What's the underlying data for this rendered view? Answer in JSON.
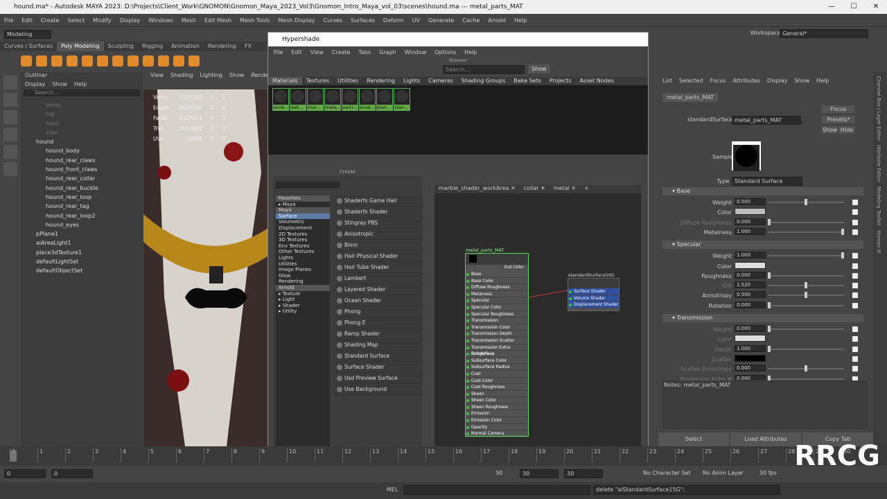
{
  "app": {
    "title": "hound.ma* - Autodesk MAYA 2023: D:\\Projects\\Client_Work\\GNOMON\\Gnomon_Maya_2023_Vol3\\Gnomon_Intro_Maya_vol_03\\scenes\\hound.ma   ---   metal_parts_MAT",
    "min": "—",
    "max": "☐",
    "close": "✕"
  },
  "menu": [
    "File",
    "Edit",
    "Create",
    "Select",
    "Modify",
    "Display",
    "Windows",
    "Mesh",
    "Edit Mesh",
    "Mesh Tools",
    "Mesh Display",
    "Curves",
    "Surfaces",
    "Deform",
    "UV",
    "Generate",
    "Cache",
    "Arnold",
    "Help"
  ],
  "workspace": {
    "label": "Workspace:",
    "value": "General*"
  },
  "mode": "Modeling",
  "shelf_tabs": [
    "Curves / Surfaces",
    "Poly Modeling",
    "Sculpting",
    "Rigging",
    "Animation",
    "Rendering",
    "FX"
  ],
  "shelf_active": "Poly Modeling",
  "outliner": {
    "title": "Outliner",
    "menu": [
      "Display",
      "Show",
      "Help"
    ],
    "search": "Search...",
    "items": [
      {
        "name": "persp",
        "indent": 1,
        "dim": true
      },
      {
        "name": "top",
        "indent": 1,
        "dim": true
      },
      {
        "name": "front",
        "indent": 1,
        "dim": true
      },
      {
        "name": "side",
        "indent": 1,
        "dim": true
      },
      {
        "name": "hound",
        "indent": 0,
        "dim": false
      },
      {
        "name": "hound_body",
        "indent": 1,
        "dim": false
      },
      {
        "name": "hound_rear_claws",
        "indent": 1,
        "dim": false
      },
      {
        "name": "hound_front_claws",
        "indent": 1,
        "dim": false
      },
      {
        "name": "hound_rear_collar",
        "indent": 1,
        "dim": false
      },
      {
        "name": "hound_rear_buckle",
        "indent": 1,
        "dim": false
      },
      {
        "name": "hound_rear_loop",
        "indent": 1,
        "dim": false
      },
      {
        "name": "hound_rear_tag",
        "indent": 1,
        "dim": false
      },
      {
        "name": "hound_rear_loop2",
        "indent": 1,
        "dim": false
      },
      {
        "name": "hound_eyes",
        "indent": 1,
        "dim": false
      },
      {
        "name": "pPlane1",
        "indent": 0,
        "dim": false
      },
      {
        "name": "aiAreaLight1",
        "indent": 0,
        "dim": false
      },
      {
        "name": "place3dTexture1",
        "indent": 0,
        "dim": false
      },
      {
        "name": "defaultLightSet",
        "indent": 0,
        "dim": false
      },
      {
        "name": "defaultObjectSet",
        "indent": 0,
        "dim": false
      }
    ]
  },
  "viewport": {
    "menu": [
      "View",
      "Shading",
      "Lighting",
      "Show",
      "Renderer"
    ],
    "stats": [
      {
        "k": "Verts:",
        "a": "3327344",
        "b": "0",
        "c": "0"
      },
      {
        "k": "Edges:",
        "a": "6654330",
        "b": "0",
        "c": "0"
      },
      {
        "k": "Faces:",
        "a": "3327024",
        "b": "0",
        "c": "0"
      },
      {
        "k": "Tris:",
        "a": "6654048",
        "b": "0",
        "c": "0"
      },
      {
        "k": "UVs:",
        "a": "39848",
        "b": "0",
        "c": "0"
      }
    ]
  },
  "hypershade": {
    "title": "Hypershade",
    "menu": [
      "File",
      "Edit",
      "View",
      "Create",
      "Tabs",
      "Graph",
      "Window",
      "Options",
      "Help"
    ],
    "browser_label": "Browser",
    "search": "Search...",
    "show_btn": "Show",
    "tabs": [
      "Materials",
      "Textures",
      "Utilities",
      "Rendering",
      "Lights",
      "Cameras",
      "Shading Groups",
      "Bake Sets",
      "Projects",
      "Asset Nodes"
    ],
    "swatches": [
      "lamb...",
      "leat...",
      "mar...",
      "meta...",
      "parti...",
      "shad...",
      "stan...",
      "stan..."
    ],
    "create_label": "Create",
    "tree": [
      {
        "t": "Favorites",
        "g": true
      },
      {
        "t": "▸ Maya",
        "g": false
      },
      {
        "t": "Maya",
        "g": true
      },
      {
        "t": "Surface",
        "s": true
      },
      {
        "t": "Volumetric"
      },
      {
        "t": "Displacement"
      },
      {
        "t": "2D Textures"
      },
      {
        "t": "3D Textures"
      },
      {
        "t": "Env Textures"
      },
      {
        "t": "Other Textures"
      },
      {
        "t": "Lights"
      },
      {
        "t": "Utilities"
      },
      {
        "t": "Image Planes"
      },
      {
        "t": "Glow"
      },
      {
        "t": "Rendering"
      },
      {
        "t": "Arnold",
        "g": true
      },
      {
        "t": "▸ Texture"
      },
      {
        "t": "▸ Light"
      },
      {
        "t": "▸ Shader"
      },
      {
        "t": "▸ Utility"
      }
    ],
    "shaders": [
      "Shaderfx Game Hair",
      "Shaderfx Shader",
      "Stingray PBS",
      "Anisotropic",
      "Blinn",
      "Hair Physical Shader",
      "Hair Tube Shader",
      "Lambert",
      "Layered Shader",
      "Ocean Shader",
      "Phong",
      "Phong E",
      "Ramp Shader",
      "Shading Map",
      "Standard Surface",
      "Surface Shader",
      "Usd Preview Surface",
      "Use Background"
    ],
    "graph_tabs": [
      "marble_shader_workArea ✕",
      "collar ✕",
      "metal ✕",
      "+"
    ],
    "node1": {
      "title": "metal_parts_MAT",
      "out": "Out Color",
      "ports": [
        "Base",
        "Base Color",
        "Diffuse Roughness",
        "Metalness",
        "Specular",
        "Specular Color",
        "Specular Roughness",
        "Transmission",
        "Transmission Color",
        "Transmission Depth",
        "Transmission Scatter",
        "Transmission Extra Roughness",
        "Subsurface",
        "Subsurface Color",
        "Subsurface Radius",
        "Coat",
        "Coat Color",
        "Coat Roughness",
        "Sheen",
        "Sheen Color",
        "Sheen Roughness",
        "Emission",
        "Emission Color",
        "Opacity",
        "Normal Camera"
      ]
    },
    "node2": {
      "title": "standardSurface5SG",
      "ports": [
        "Surface Shader",
        "Volume Shader",
        "Displacement Shader"
      ]
    }
  },
  "attr": {
    "menu": [
      "List",
      "Selected",
      "Focus",
      "Attributes",
      "Display",
      "Show",
      "Help"
    ],
    "tab": "metal_parts_MAT",
    "type_label": "standardSurface:",
    "name": "metal_parts_MAT",
    "focus": "Focus",
    "presets": "Presets*",
    "show": "Show",
    "hide": "Hide",
    "sample": "Sample",
    "type_k": "Type",
    "type_v": "Standard Surface",
    "sections": [
      {
        "title": "Base",
        "rows": [
          {
            "k": "Weight",
            "v": "0.500",
            "s": 0.5
          },
          {
            "k": "Color",
            "v": "",
            "c": "#bbbbbb"
          },
          {
            "k": "Diffuse Roughness",
            "v": "0.000",
            "s": 0,
            "dim": true
          },
          {
            "k": "Metalness",
            "v": "1.000",
            "s": 1
          }
        ]
      },
      {
        "title": "Specular",
        "rows": [
          {
            "k": "Weight",
            "v": "1.000",
            "s": 1
          },
          {
            "k": "Color",
            "v": "",
            "c": "#dddddd"
          },
          {
            "k": "Roughness",
            "v": "0.000",
            "s": 0
          },
          {
            "k": "IOR",
            "v": "1.520",
            "s": 0.5,
            "dim": true
          },
          {
            "k": "Anisotropy",
            "v": "0.500",
            "s": 0.5
          },
          {
            "k": "Rotation",
            "v": "0.000",
            "s": 0
          }
        ]
      },
      {
        "title": "Transmission",
        "rows": [
          {
            "k": "Weight",
            "v": "0.000",
            "s": 0,
            "dim": true
          },
          {
            "k": "Color",
            "v": "",
            "c": "#dddddd",
            "dim": true
          },
          {
            "k": "Depth",
            "v": "1.000",
            "s": 0,
            "dim": true
          },
          {
            "k": "Scatter",
            "v": "",
            "c": "#000000",
            "dim": true
          },
          {
            "k": "Scatter Anisotropy",
            "v": "0.000",
            "s": 0.5,
            "dim": true
          },
          {
            "k": "Dispersion Abbe #",
            "v": "0.000",
            "s": 0,
            "dim": true
          }
        ]
      }
    ],
    "notes": "Notes: metal_parts_MAT",
    "btn_select": "Select",
    "btn_load": "Load Attributes",
    "btn_copy": "Copy Tab"
  },
  "sidebar": [
    "Channel Box / Layer Editor",
    "Attribute Editor",
    "Modeling Toolkit",
    "Human IK"
  ],
  "timeline": {
    "start": "0",
    "ticks": [
      "0",
      "1",
      "2",
      "3",
      "4",
      "5",
      "6",
      "7",
      "8",
      "9",
      "10",
      "11",
      "12",
      "13",
      "14",
      "15",
      "16",
      "17",
      "18",
      "19",
      "20",
      "21",
      "22",
      "23",
      "24",
      "25",
      "26",
      "27",
      "28",
      "29",
      "30"
    ],
    "end_nums": [
      "27",
      "28",
      "29",
      "30"
    ]
  },
  "range": {
    "a": "0",
    "b": "0",
    "c": "30",
    "d": "30",
    "e": "30",
    "char": "No Character Set",
    "anim": "No Anim Layer",
    "fps": "30 fps"
  },
  "cmd": {
    "lang": "MEL",
    "result": "delete \"aiStandardSurface15G\";"
  },
  "watermark": "RRCG"
}
